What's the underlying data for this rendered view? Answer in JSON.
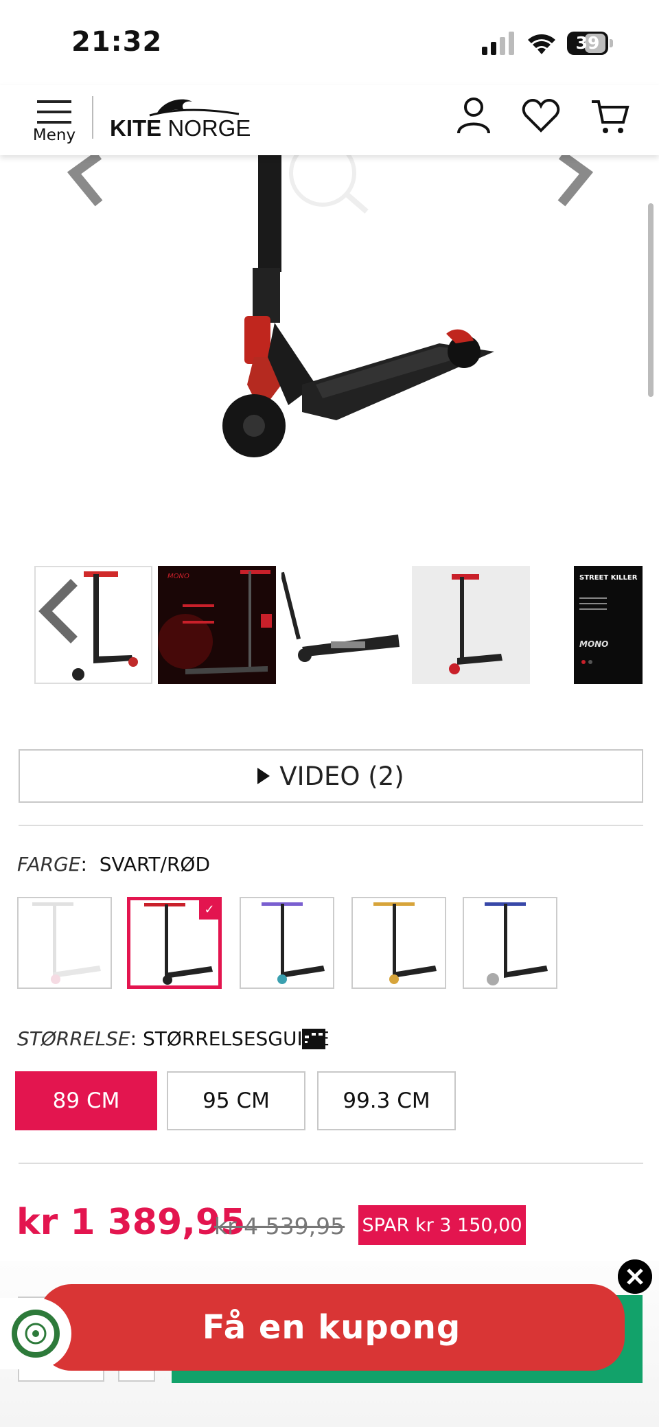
{
  "status_bar": {
    "time": "21:32",
    "battery": "39"
  },
  "header": {
    "menu_label": "Meny",
    "logo": {
      "bold": "KITE",
      "normal": " NORGE"
    },
    "icons": [
      "account-icon",
      "wishlist-heart-icon",
      "cart-icon"
    ]
  },
  "gallery": {
    "thumbnails": [
      {
        "name": "thumb-scooter-side"
      },
      {
        "name": "thumb-mono-street-specs"
      },
      {
        "name": "thumb-scooter-deck"
      },
      {
        "name": "thumb-scooter-studio"
      },
      {
        "name": "thumb-street-killer-promo"
      }
    ]
  },
  "video": {
    "label": "VIDEO (2)"
  },
  "color": {
    "label": "FARGE",
    "value": "SVART/RØD",
    "selected_index": 1,
    "swatches": [
      {
        "accent": "#f2d0dc"
      },
      {
        "accent": "#e3154f"
      },
      {
        "accent": "#7a5fd0"
      },
      {
        "accent": "#d7a43a"
      },
      {
        "accent": "#3848a8"
      }
    ]
  },
  "size": {
    "label": "STØRRELSE",
    "guide": "STØRRELSESGUIDE",
    "options": [
      "89 CM",
      "95 CM",
      "99.3 CM"
    ],
    "selected_index": 0
  },
  "price": {
    "current": "kr 1 389,95",
    "original": "kr 4 539,95",
    "save": "SPAR kr 3 150,00"
  },
  "coupon": {
    "label": "Få en kupong"
  },
  "colors": {
    "accent": "#e3154f",
    "coupon_bg": "#d93535",
    "cart_green": "#12a26a"
  }
}
